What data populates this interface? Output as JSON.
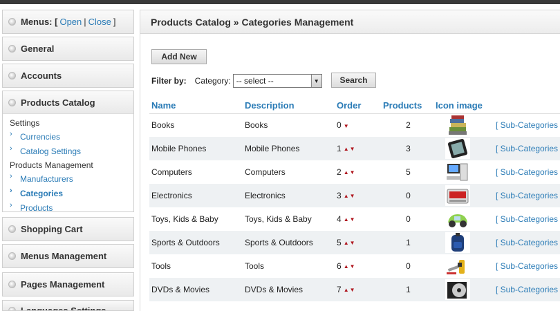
{
  "sidebar": {
    "menus": {
      "label": "Menus: [",
      "open": "Open",
      "pipe": "|",
      "close": "Close",
      "end": "]"
    },
    "panels": [
      "General",
      "Accounts",
      "Products Catalog",
      "Shopping Cart",
      "Menus Management",
      "Pages Management",
      "Languages Settings"
    ],
    "catalog": {
      "settings_label": "Settings",
      "settings_items": [
        "Currencies",
        "Catalog Settings"
      ],
      "pm_label": "Products Management",
      "pm_items": [
        "Manufacturers",
        "Categories",
        "Products"
      ]
    }
  },
  "main": {
    "title": "Products Catalog » Categories Management",
    "add_new": "Add New",
    "filter_by": "Filter by:",
    "category_label": "Category:",
    "select_value": "-- select --",
    "search": "Search",
    "columns": [
      "Name",
      "Description",
      "Order",
      "Products",
      "Icon image"
    ],
    "rows": [
      {
        "name": "Books",
        "desc": "Books",
        "order": "0",
        "products": "2",
        "icon": "books-icon"
      },
      {
        "name": "Mobile Phones",
        "desc": "Mobile Phones",
        "order": "1",
        "products": "3",
        "icon": "tablet-icon"
      },
      {
        "name": "Computers",
        "desc": "Computers",
        "order": "2",
        "products": "5",
        "icon": "computer-icon"
      },
      {
        "name": "Electronics",
        "desc": "Electronics",
        "order": "3",
        "products": "0",
        "icon": "electronics-icon"
      },
      {
        "name": "Toys, Kids & Baby",
        "desc": "Toys, Kids & Baby",
        "order": "4",
        "products": "0",
        "icon": "toy-car-icon"
      },
      {
        "name": "Sports & Outdoors",
        "desc": "Sports & Outdoors",
        "order": "5",
        "products": "1",
        "icon": "backpack-icon"
      },
      {
        "name": "Tools",
        "desc": "Tools",
        "order": "6",
        "products": "0",
        "icon": "tools-icon"
      },
      {
        "name": "DVDs & Movies",
        "desc": "DVDs & Movies",
        "order": "7",
        "products": "1",
        "icon": "dvd-icon"
      }
    ],
    "subcat_link": "[ Sub-Categories"
  },
  "colors": {
    "link": "#2a7bb6",
    "arrow": "#b0171f",
    "row_alt": "#eef1f3"
  }
}
